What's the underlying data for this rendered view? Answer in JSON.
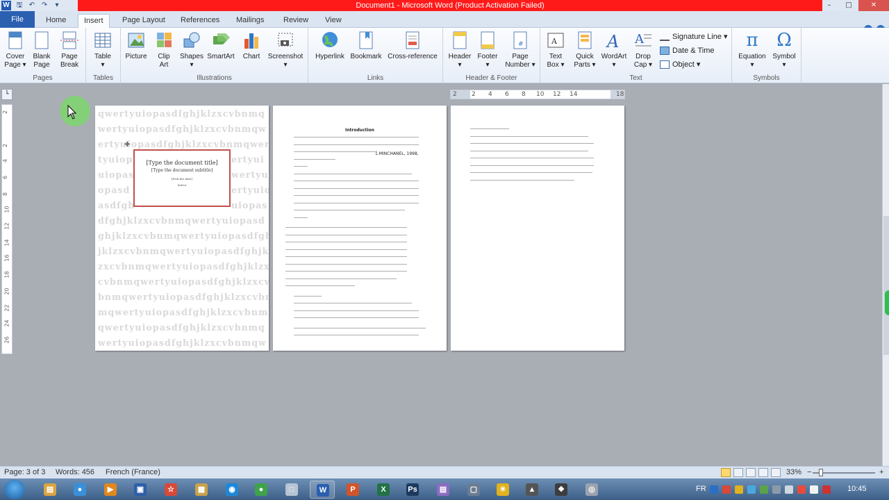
{
  "window": {
    "title": "Document1 - Microsoft Word (Product Activation Failed)",
    "minimize": "–",
    "maximize": "□",
    "close": "✕"
  },
  "qat": {
    "logo": "W",
    "save_icon": "save-icon",
    "undo_icon": "undo-icon",
    "redo_icon": "redo-icon"
  },
  "tabs": {
    "file": "File",
    "items": [
      "Home",
      "Insert",
      "Page Layout",
      "References",
      "Mailings",
      "Review",
      "View"
    ],
    "active": "Insert"
  },
  "ribbon": {
    "groups": {
      "pages": "Pages",
      "tables": "Tables",
      "illustrations": "Illustrations",
      "links": "Links",
      "header_footer": "Header & Footer",
      "text": "Text",
      "symbols": "Symbols"
    },
    "buttons": {
      "cover_page_1": "Cover",
      "cover_page_2": "Page ▾",
      "blank_page_1": "Blank",
      "blank_page_2": "Page",
      "page_break_1": "Page",
      "page_break_2": "Break",
      "table_1": "Table",
      "table_2": "▾",
      "picture": "Picture",
      "clip_art_1": "Clip",
      "clip_art_2": "Art",
      "shapes_1": "Shapes",
      "shapes_2": "▾",
      "smartart": "SmartArt",
      "chart": "Chart",
      "screenshot_1": "Screenshot",
      "screenshot_2": "▾",
      "hyperlink": "Hyperlink",
      "bookmark": "Bookmark",
      "cross_reference": "Cross-reference",
      "header_1": "Header",
      "header_2": "▾",
      "footer_1": "Footer",
      "footer_2": "▾",
      "page_number_1": "Page",
      "page_number_2": "Number ▾",
      "text_box_1": "Text",
      "text_box_2": "Box ▾",
      "quick_parts_1": "Quick",
      "quick_parts_2": "Parts ▾",
      "wordart_1": "WordArt",
      "wordart_2": "▾",
      "drop_cap_1": "Drop",
      "drop_cap_2": "Cap ▾",
      "signature_line": "Signature Line ▾",
      "date_time": "Date & Time",
      "object": "Object ▾",
      "equation_1": "Equation",
      "equation_2": "▾",
      "symbol_1": "Symbol",
      "symbol_2": "▾",
      "equation_glyph": "π",
      "symbol_glyph": "Ω"
    }
  },
  "ruler": {
    "h_labels": [
      "2",
      "2",
      "4",
      "6",
      "8",
      "10",
      "12",
      "14",
      "18"
    ],
    "v_labels": [
      "2",
      "2",
      "4",
      "6",
      "8",
      "10",
      "12",
      "14",
      "16",
      "18",
      "20",
      "22",
      "24",
      "26"
    ]
  },
  "cover": {
    "watermark_lines": [
      "qwertyuiopasdfghjklzxcvbnmq",
      "wertyuiopasdfghjklzxcvbnmqw",
      "ertyuiopasdfghjklzxcvbnmqwer",
      "tyuiop",
      "uiopas",
      "opasd",
      "asdfgh",
      "dfghjklzxcvbnmqwertyuiopasd",
      "ghjklzxcvbnmqwertyuiopasdfgh",
      "jklzxcvbnmqwertyuiopasdfghjki",
      "zxcvbnmqwertyuiopasdfghjklzx",
      "cvbnmqwertyuiopasdfghjklzxcv",
      "bnmqwertyuiopasdfghjklzxcvbn",
      "mqwertyuiopasdfghjklzxcvbnm",
      "qwertyuiopasdfghjklzxcvbnmq",
      "wertyuiopasdfghjklzxcvbnmqw"
    ],
    "watermark_right": [
      "ertyui",
      "wertyui",
      "ertyuiop",
      "uiopas"
    ],
    "title": "[Type the document title]",
    "subtitle": "[Type the document subtitle]",
    "author": "[Pick the date]",
    "date": "Select"
  },
  "page2": {
    "heading": "Introduction",
    "inline": "1.MINCHANEL, 1998,"
  },
  "status": {
    "page": "Page: 3 of 3",
    "words": "Words: 456",
    "language": "French (France)",
    "zoom": "33%",
    "zoom_minus": "−",
    "zoom_plus": "+",
    "zoom_level": 0.33
  },
  "taskbar": {
    "lang": "FR",
    "time": "10:45",
    "apps": [
      {
        "glyph": "▤",
        "color": "#d9a441"
      },
      {
        "glyph": "●",
        "color": "#3a8fd8"
      },
      {
        "glyph": "▶",
        "color": "#e0871e"
      },
      {
        "glyph": "▣",
        "color": "#2e5fa8"
      },
      {
        "glyph": "☆",
        "color": "#d8493a"
      },
      {
        "glyph": "▦",
        "color": "#c9a24a"
      },
      {
        "glyph": "◉",
        "color": "#1e88d8"
      },
      {
        "glyph": "●",
        "color": "#3fa34a"
      },
      {
        "glyph": "□",
        "color": "#b7c4d4"
      },
      {
        "glyph": "W",
        "color": "#2a5fb0"
      },
      {
        "glyph": "P",
        "color": "#d2552a"
      },
      {
        "glyph": "X",
        "color": "#217346"
      },
      {
        "glyph": "Ps",
        "color": "#1b3a5e"
      },
      {
        "glyph": "▤",
        "color": "#8c6cc2"
      },
      {
        "glyph": "▢",
        "color": "#6b7d92"
      },
      {
        "glyph": "☀",
        "color": "#e0b21e"
      },
      {
        "glyph": "▲",
        "color": "#555"
      },
      {
        "glyph": "❖",
        "color": "#3d3d3d"
      },
      {
        "glyph": "◎",
        "color": "#9aa3ad"
      }
    ]
  }
}
